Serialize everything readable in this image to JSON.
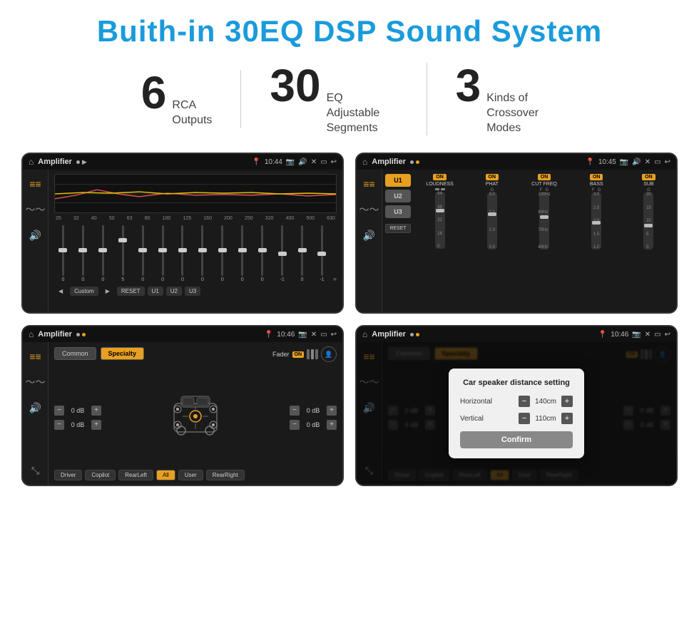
{
  "page": {
    "title": "Buith-in 30EQ DSP Sound System",
    "stats": [
      {
        "number": "6",
        "label": "RCA\nOutputs"
      },
      {
        "number": "30",
        "label": "EQ Adjustable\nSegments"
      },
      {
        "number": "3",
        "label": "Kinds of\nCrossover Modes"
      }
    ],
    "screens": [
      {
        "id": "screen1",
        "title": "Amplifier",
        "time": "10:44",
        "type": "eq",
        "frequencies": [
          "25",
          "32",
          "40",
          "50",
          "63",
          "80",
          "100",
          "125",
          "160",
          "200",
          "250",
          "320",
          "400",
          "500",
          "630"
        ],
        "values": [
          "0",
          "0",
          "0",
          "5",
          "0",
          "0",
          "0",
          "0",
          "0",
          "0",
          "0",
          "-1",
          "0",
          "-1"
        ],
        "presets": [
          "Custom",
          "RESET",
          "U1",
          "U2",
          "U3"
        ]
      },
      {
        "id": "screen2",
        "title": "Amplifier",
        "time": "10:45",
        "type": "amplifier",
        "presets": [
          "U1",
          "U2",
          "U3"
        ],
        "controls": [
          "LOUDNESS",
          "PHAT",
          "CUT FREQ",
          "BASS",
          "SUB"
        ],
        "reset": "RESET"
      },
      {
        "id": "screen3",
        "title": "Amplifier",
        "time": "10:46",
        "type": "fader",
        "tabs": [
          "Common",
          "Specialty"
        ],
        "fader_label": "Fader",
        "fader_on": "ON",
        "values": {
          "front_left": "0 dB",
          "front_right": "0 dB",
          "rear_left": "0 dB",
          "rear_right": "0 dB"
        },
        "buttons": [
          "Driver",
          "Copilot",
          "RearLeft",
          "All",
          "User",
          "RearRight"
        ]
      },
      {
        "id": "screen4",
        "title": "Amplifier",
        "time": "10:46",
        "type": "fader_dialog",
        "tabs": [
          "Common",
          "Specialty"
        ],
        "dialog": {
          "title": "Car speaker distance setting",
          "horizontal_label": "Horizontal",
          "horizontal_value": "140cm",
          "vertical_label": "Vertical",
          "vertical_value": "110cm",
          "confirm_label": "Confirm"
        },
        "buttons": [
          "Driver",
          "Copilot",
          "RearLeft",
          "All",
          "User",
          "RearRight"
        ]
      }
    ]
  }
}
